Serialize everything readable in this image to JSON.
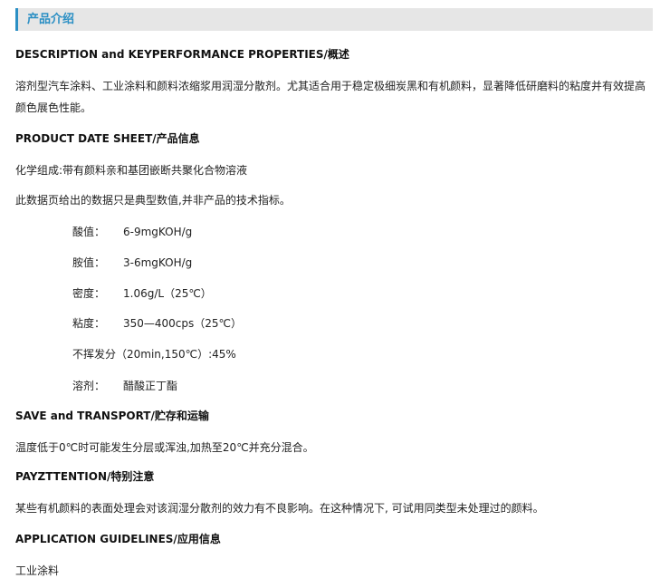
{
  "header": {
    "title": "产品介绍"
  },
  "sections": {
    "description_heading": "DESCRIPTION and KEYPERFORMANCE PROPERTIES/概述",
    "description_line1": "溶剂型汽车涂料、工业涂料和颜料浓缩浆用润湿分散剂。尤其适合用于稳定极细炭黑和有机颜料，显著降低研磨料的粘度并有效提高",
    "description_line2": "颜色展色性能。",
    "product_heading": "PRODUCT DATE SHEET/产品信息",
    "composition": "化学组成:带有颜料亲和基团嵌断共聚化合物溶液",
    "disclaimer": "此数据页给出的数据只是典型数值,并非产品的技术指标。",
    "properties": [
      {
        "label": "酸值：",
        "value": "6-9mgKOH/g"
      },
      {
        "label": "胺值：",
        "value": "3-6mgKOH/g"
      },
      {
        "label": "密度：",
        "value": "1.06g/L（25℃）"
      },
      {
        "label": "粘度：",
        "value": "350—400cps（25℃）"
      },
      {
        "label": "不挥发分（20min,150℃）:45%",
        "value": ""
      },
      {
        "label": "溶剂：",
        "value": "醋酸正丁酯"
      }
    ],
    "storage_heading": "SAVE and TRANSPORT/贮存和运输",
    "storage_text": "温度低于0℃时可能发生分层或浑浊,加热至20℃并充分混合。",
    "attention_heading": "PAYZTTENTION/特别注意",
    "attention_text": "某些有机颜料的表面处理会对该润湿分散剂的效力有不良影响。在这种情况下, 可试用同类型未处理过的颜料。",
    "application_heading": "APPLICATION GUIDELINES/应用信息",
    "application_text": "工业涂料"
  },
  "colors": {
    "accent": "#2b8fc4",
    "header_bg": "#e6e6e6",
    "text": "#222222"
  }
}
